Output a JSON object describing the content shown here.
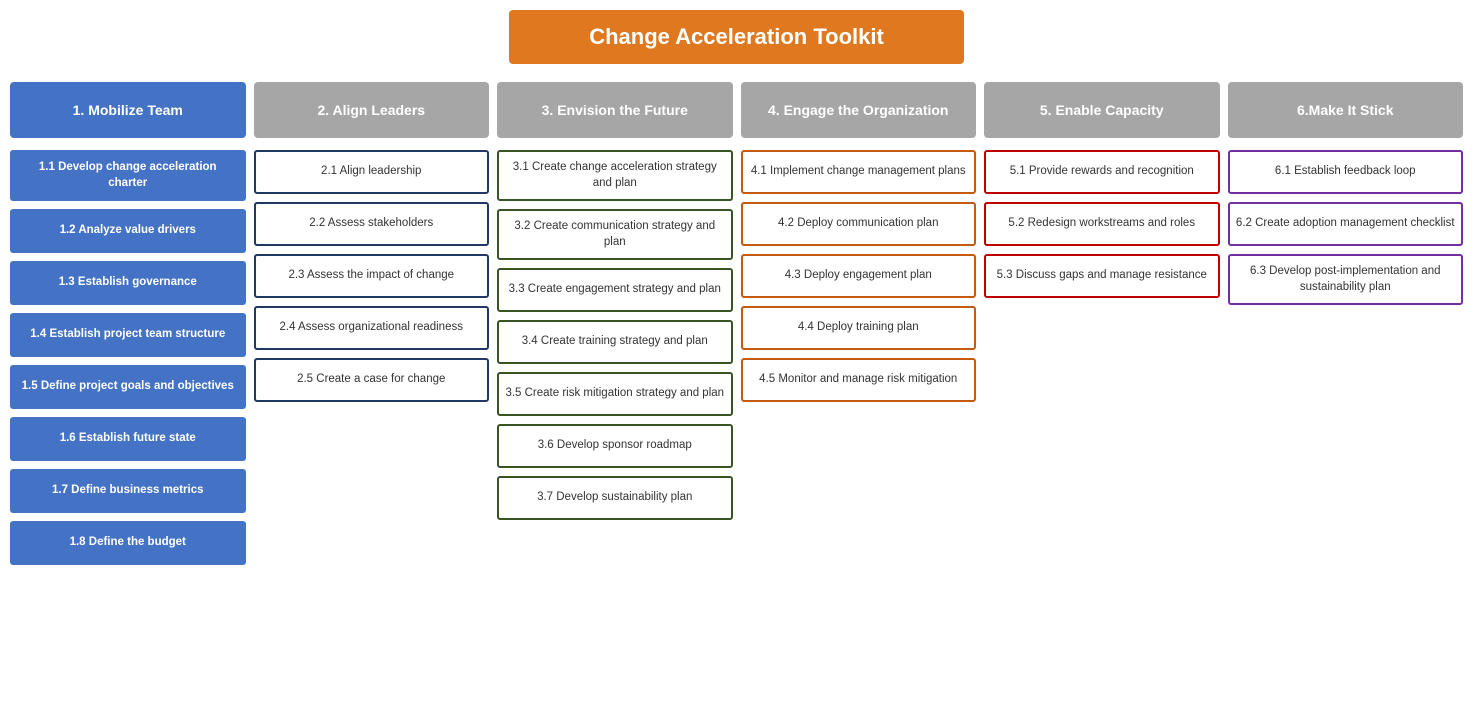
{
  "title": "Change Acceleration Toolkit",
  "columns": [
    {
      "id": "col1",
      "header": "1. Mobilize Team",
      "headerStyle": "blue",
      "cardStyle": "card-blue-fill",
      "cards": [
        "1.1 Develop change acceleration charter",
        "1.2 Analyze value drivers",
        "1.3 Establish governance",
        "1.4 Establish project team structure",
        "1.5 Define project goals and objectives",
        "1.6 Establish future state",
        "1.7 Define business metrics",
        "1.8 Define the budget"
      ]
    },
    {
      "id": "col2",
      "header": "2. Align Leaders",
      "headerStyle": "gray",
      "cardStyle": "card-darkblue-border",
      "cards": [
        "2.1 Align leadership",
        "2.2 Assess stakeholders",
        "2.3 Assess the impact of change",
        "2.4 Assess organizational readiness",
        "2.5 Create a case for change"
      ]
    },
    {
      "id": "col3",
      "header": "3. Envision the Future",
      "headerStyle": "gray",
      "cardStyle": "card-green-border",
      "cards": [
        "3.1 Create change acceleration strategy and plan",
        "3.2 Create communication strategy and plan",
        "3.3 Create engagement strategy and plan",
        "3.4 Create training strategy and plan",
        "3.5 Create risk mitigation strategy and plan",
        "3.6 Develop sponsor roadmap",
        "3.7 Develop sustainability plan"
      ]
    },
    {
      "id": "col4",
      "header": "4. Engage the Organization",
      "headerStyle": "gray",
      "cardStyle": "card-orange-border",
      "cards": [
        "4.1 Implement change management plans",
        "4.2 Deploy communication plan",
        "4.3 Deploy engagement plan",
        "4.4 Deploy training plan",
        "4.5 Monitor and manage risk mitigation"
      ]
    },
    {
      "id": "col5",
      "header": "5. Enable Capacity",
      "headerStyle": "gray",
      "cardStyle": "card-red-border",
      "cards": [
        "5.1 Provide rewards and recognition",
        "5.2 Redesign workstreams and roles",
        "5.3 Discuss gaps and manage resistance"
      ]
    },
    {
      "id": "col6",
      "header": "6.Make It Stick",
      "headerStyle": "gray",
      "cardStyle": "card-purple-border",
      "cards": [
        "6.1 Establish feedback loop",
        "6.2 Create adoption management checklist",
        "6.3 Develop post-implementation and sustainability plan"
      ]
    }
  ]
}
